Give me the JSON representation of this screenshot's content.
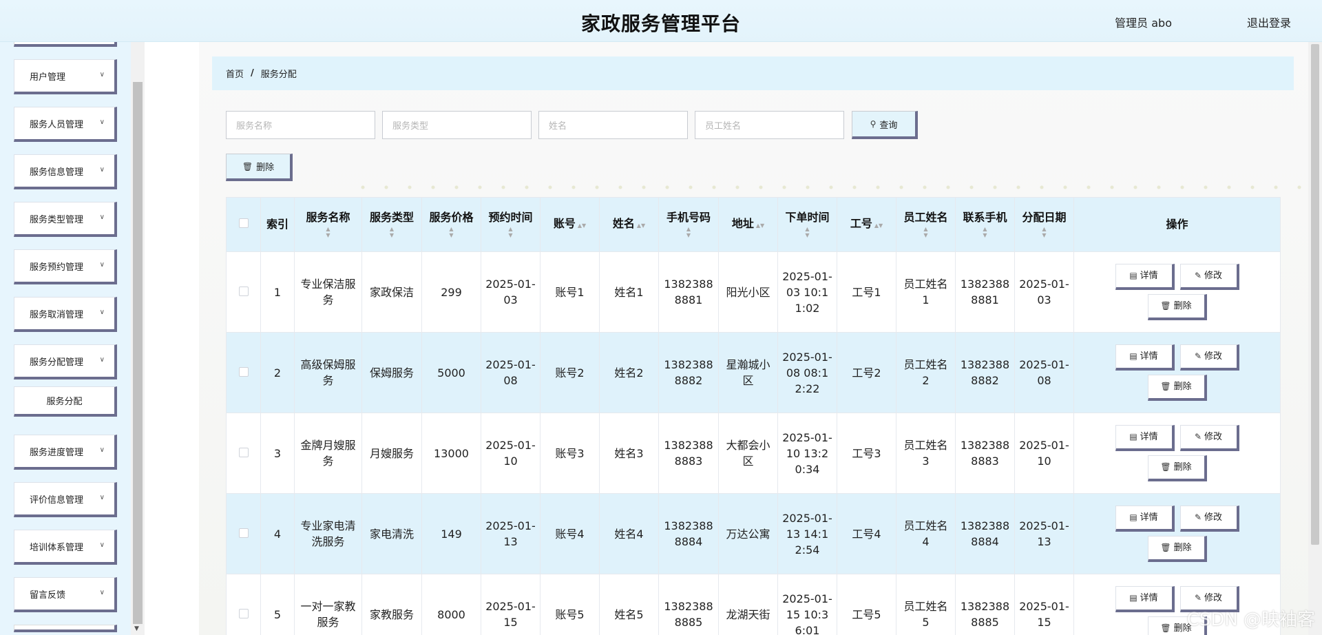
{
  "header": {
    "title": "家政服务管理平台",
    "user": "管理员 abo",
    "logout": "退出登录"
  },
  "sidebar": {
    "items": [
      {
        "label": "用户管理",
        "icon": "chevron-down-icon"
      },
      {
        "label": "服务人员管理",
        "icon": "chevron-down-icon"
      },
      {
        "label": "服务信息管理",
        "icon": "chevron-down-icon"
      },
      {
        "label": "服务类型管理",
        "icon": "chevron-down-icon"
      },
      {
        "label": "服务预约管理",
        "icon": "chevron-down-icon"
      },
      {
        "label": "服务取消管理",
        "icon": "chevron-down-icon"
      },
      {
        "label": "服务分配管理",
        "icon": "chevron-down-icon"
      },
      {
        "label": "服务进度管理",
        "icon": "chevron-down-icon"
      },
      {
        "label": "评价信息管理",
        "icon": "chevron-down-icon"
      },
      {
        "label": "培训体系管理",
        "icon": "chevron-down-icon"
      },
      {
        "label": "留言反馈",
        "icon": "chevron-down-icon"
      }
    ],
    "subitem": "服务分配"
  },
  "breadcrumb": {
    "home": "首页",
    "separator": "/",
    "current": "服务分配"
  },
  "search": {
    "service_name_placeholder": "服务名称",
    "service_type_placeholder": "服务类型",
    "name_placeholder": "姓名",
    "staff_name_placeholder": "员工姓名",
    "query_label": "查询"
  },
  "toolbar": {
    "delete_label": "删除"
  },
  "table": {
    "columns": [
      "索引",
      "服务名称",
      "服务类型",
      "服务价格",
      "预约时间",
      "账号",
      "姓名",
      "手机号码",
      "地址",
      "下单时间",
      "工号",
      "员工姓名",
      "联系手机",
      "分配日期",
      "操作"
    ],
    "actions": {
      "detail": "详情",
      "edit": "修改",
      "delete": "删除"
    },
    "rows": [
      {
        "index": "1",
        "service_name": "专业保洁服务",
        "service_type": "家政保洁",
        "price": "299",
        "appointment_time": "2025-01-03",
        "account": "账号1",
        "name": "姓名1",
        "phone": "13823888881",
        "address": "阳光小区",
        "order_time": "2025-01-03 10:11:02",
        "staff_no": "工号1",
        "staff_name": "员工姓名1",
        "contact_phone": "13823888881",
        "assign_date": "2025-01-03"
      },
      {
        "index": "2",
        "service_name": "高级保姆服务",
        "service_type": "保姆服务",
        "price": "5000",
        "appointment_time": "2025-01-08",
        "account": "账号2",
        "name": "姓名2",
        "phone": "13823888882",
        "address": "星瀚城小区",
        "order_time": "2025-01-08 08:12:22",
        "staff_no": "工号2",
        "staff_name": "员工姓名2",
        "contact_phone": "13823888882",
        "assign_date": "2025-01-08"
      },
      {
        "index": "3",
        "service_name": "金牌月嫂服务",
        "service_type": "月嫂服务",
        "price": "13000",
        "appointment_time": "2025-01-10",
        "account": "账号3",
        "name": "姓名3",
        "phone": "13823888883",
        "address": "大都会小区",
        "order_time": "2025-01-10 13:20:34",
        "staff_no": "工号3",
        "staff_name": "员工姓名3",
        "contact_phone": "13823888883",
        "assign_date": "2025-01-10"
      },
      {
        "index": "4",
        "service_name": "专业家电清洗服务",
        "service_type": "家电清洗",
        "price": "149",
        "appointment_time": "2025-01-13",
        "account": "账号4",
        "name": "姓名4",
        "phone": "13823888884",
        "address": "万达公寓",
        "order_time": "2025-01-13 14:12:54",
        "staff_no": "工号4",
        "staff_name": "员工姓名4",
        "contact_phone": "13823888884",
        "assign_date": "2025-01-13"
      },
      {
        "index": "5",
        "service_name": "一对一家教服务",
        "service_type": "家教服务",
        "price": "8000",
        "appointment_time": "2025-01-15",
        "account": "账号5",
        "name": "姓名5",
        "phone": "13823888885",
        "address": "龙湖天街",
        "order_time": "2025-01-15 10:36:01",
        "staff_no": "工号5",
        "staff_name": "员工姓名5",
        "contact_phone": "13823888885",
        "assign_date": "2025-01-15"
      }
    ]
  },
  "watermark": "CSDN @映袖客"
}
